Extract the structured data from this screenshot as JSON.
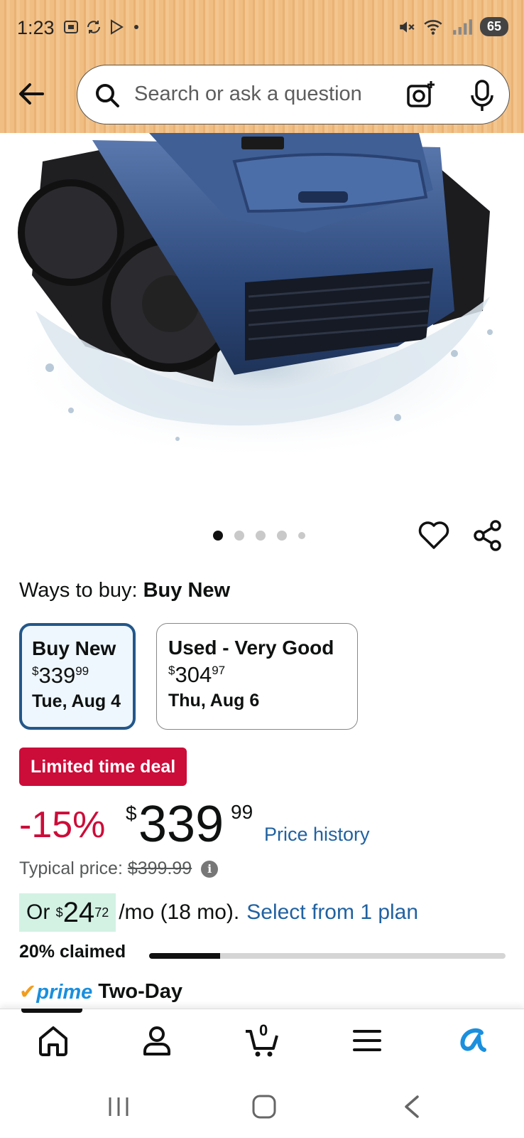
{
  "status_bar": {
    "time": "1:23",
    "battery": "65",
    "signal_sup": "6"
  },
  "search": {
    "placeholder": "Search or ask a question"
  },
  "gallery": {
    "image_count": 5,
    "active_index": 0
  },
  "ways_to_buy": {
    "label": "Ways to buy:",
    "selected": "Buy New"
  },
  "options": [
    {
      "title": "Buy New",
      "currency": "$",
      "whole": "339",
      "fraction": "99",
      "delivery": "Tue, Aug 4"
    },
    {
      "title": "Used - Very Good",
      "currency": "$",
      "whole": "304",
      "fraction": "97",
      "delivery": "Thu, Aug 6"
    }
  ],
  "deal_badge": "Limited time deal",
  "price": {
    "discount": "-15%",
    "currency": "$",
    "whole": "339",
    "fraction": "99",
    "history_link": "Price history"
  },
  "typical": {
    "label": "Typical price:",
    "value": "$399.99"
  },
  "monthly": {
    "prefix": "Or",
    "currency": "$",
    "whole": "24",
    "fraction": "72",
    "suffix": "/mo (18 mo).",
    "link": "Select from 1 plan"
  },
  "claimed": {
    "label": "20% claimed",
    "fraction": 0.2
  },
  "prime": {
    "logo_text": "prime",
    "label": "Two-Day"
  },
  "nav": {
    "cart_count": "0"
  },
  "colors": {
    "deal_red": "#cc0c39",
    "link_blue": "#2162a1",
    "selected_border": "#23578a",
    "header_orange": "#f0be83"
  }
}
